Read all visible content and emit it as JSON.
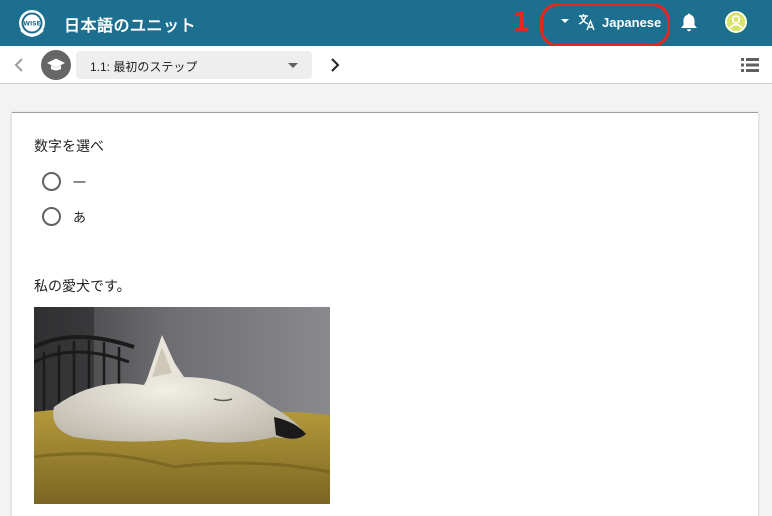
{
  "app": {
    "title": "日本語のユニット",
    "annotation_number": "1",
    "language_label": "Japanese"
  },
  "stepnav": {
    "selected_step": "1.1: 最初のステップ"
  },
  "content": {
    "question": "数字を選べ",
    "options": [
      {
        "label": "一"
      },
      {
        "label": "あ"
      }
    ],
    "caption": "私の愛犬です。"
  },
  "colors": {
    "appbar": "#1c6f8f",
    "annotation": "#e8261b",
    "avatar": "#d8e36a"
  },
  "icons": [
    "logo-icon",
    "caret-down-icon",
    "translate-icon",
    "bell-icon",
    "account-icon",
    "chevron-left-icon",
    "school-icon",
    "chevron-right-icon",
    "view-list-icon"
  ]
}
